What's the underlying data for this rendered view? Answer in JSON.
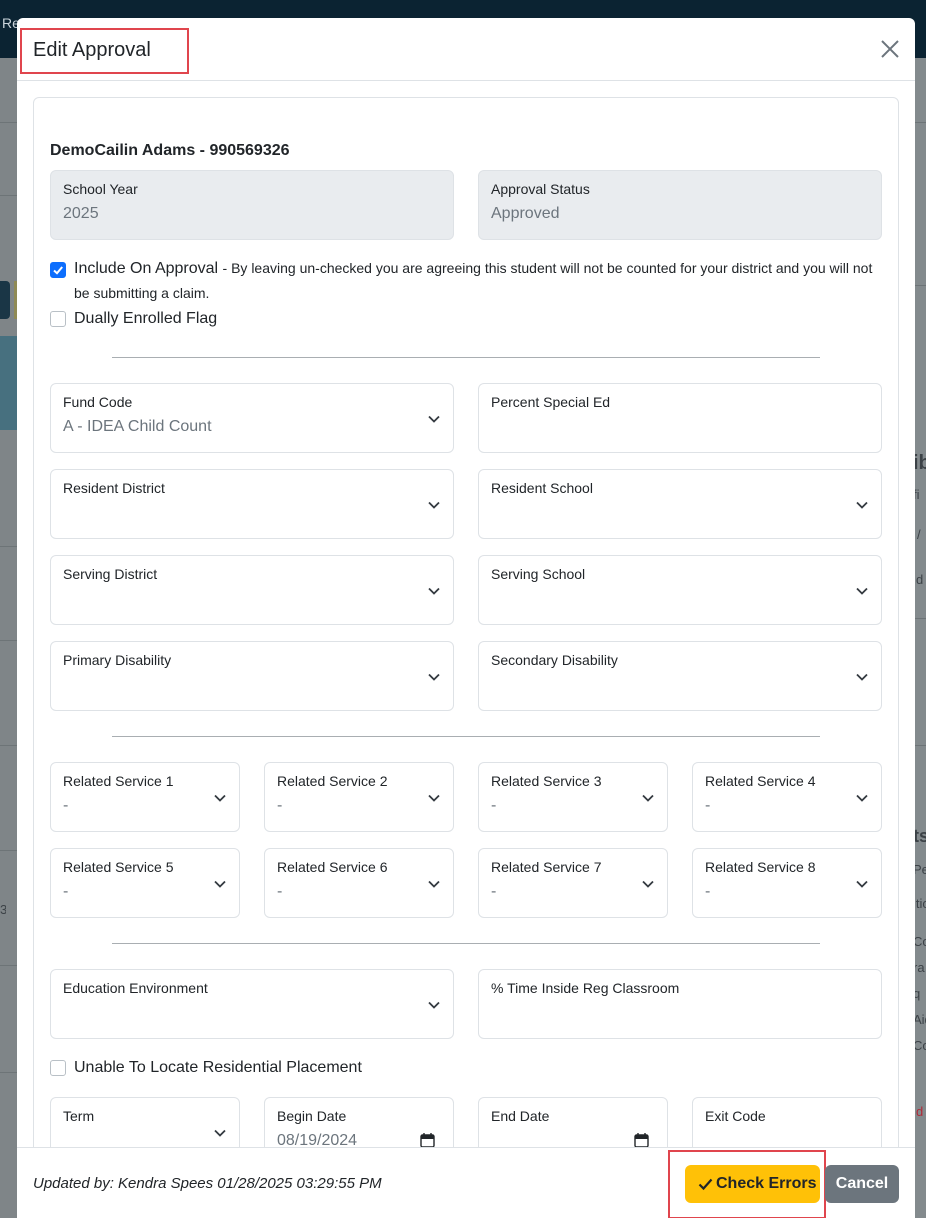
{
  "background": {
    "topbar_text": "Re",
    "right_texts": [
      "ib",
      "fi",
      "/",
      "d",
      "ts",
      "Pe",
      "itio",
      "Co",
      "ra",
      "q",
      "Aid",
      "Co",
      "d",
      "3"
    ]
  },
  "modal": {
    "title": "Edit Approval",
    "close_icon": "close-icon",
    "student": "DemoCailin Adams - 990569326",
    "school_year": {
      "label": "School Year",
      "value": "2025"
    },
    "approval_status": {
      "label": "Approval Status",
      "value": "Approved"
    },
    "include_on_approval": {
      "label": "Include On Approval",
      "description_line1": "- By leaving un-checked you are agreeing this student will not be counted for your district and you will not",
      "description_line2": "be submitting a claim.",
      "checked": true
    },
    "dually_enrolled": {
      "label": "Dually Enrolled Flag",
      "checked": false
    },
    "fund_code": {
      "label": "Fund Code",
      "value": "A - IDEA Child Count"
    },
    "percent_special_ed": {
      "label": "Percent Special Ed",
      "value": ""
    },
    "resident_district": {
      "label": "Resident District",
      "value": ""
    },
    "resident_school": {
      "label": "Resident School",
      "value": ""
    },
    "serving_district": {
      "label": "Serving District",
      "value": ""
    },
    "serving_school": {
      "label": "Serving School",
      "value": ""
    },
    "primary_disability": {
      "label": "Primary Disability",
      "value": ""
    },
    "secondary_disability": {
      "label": "Secondary Disability",
      "value": ""
    },
    "related_services": [
      {
        "label": "Related Service 1",
        "value": "-"
      },
      {
        "label": "Related Service 2",
        "value": "-"
      },
      {
        "label": "Related Service 3",
        "value": "-"
      },
      {
        "label": "Related Service 4",
        "value": "-"
      },
      {
        "label": "Related Service 5",
        "value": "-"
      },
      {
        "label": "Related Service 6",
        "value": "-"
      },
      {
        "label": "Related Service 7",
        "value": "-"
      },
      {
        "label": "Related Service 8",
        "value": "-"
      }
    ],
    "education_environment": {
      "label": "Education Environment",
      "value": ""
    },
    "time_inside_reg": {
      "label": "% Time Inside Reg Classroom",
      "value": ""
    },
    "unable_to_locate": {
      "label": "Unable To Locate Residential Placement",
      "checked": false
    },
    "term": {
      "label": "Term",
      "value": ""
    },
    "begin_date": {
      "label": "Begin Date",
      "value": "08/19/2024"
    },
    "end_date": {
      "label": "End Date",
      "value": ""
    },
    "exit_code": {
      "label": "Exit Code",
      "value": ""
    },
    "footer": {
      "updated_by": "Updated by: Kendra Spees 01/28/2025 03:29:55 PM",
      "check_errors_label": "Check Errors",
      "check_errors_icon": "check-icon",
      "cancel_label": "Cancel"
    }
  },
  "colors": {
    "primary": "#0d6efd",
    "warning": "#ffc107",
    "secondary": "#6c757d",
    "highlight": "#e0454d"
  }
}
